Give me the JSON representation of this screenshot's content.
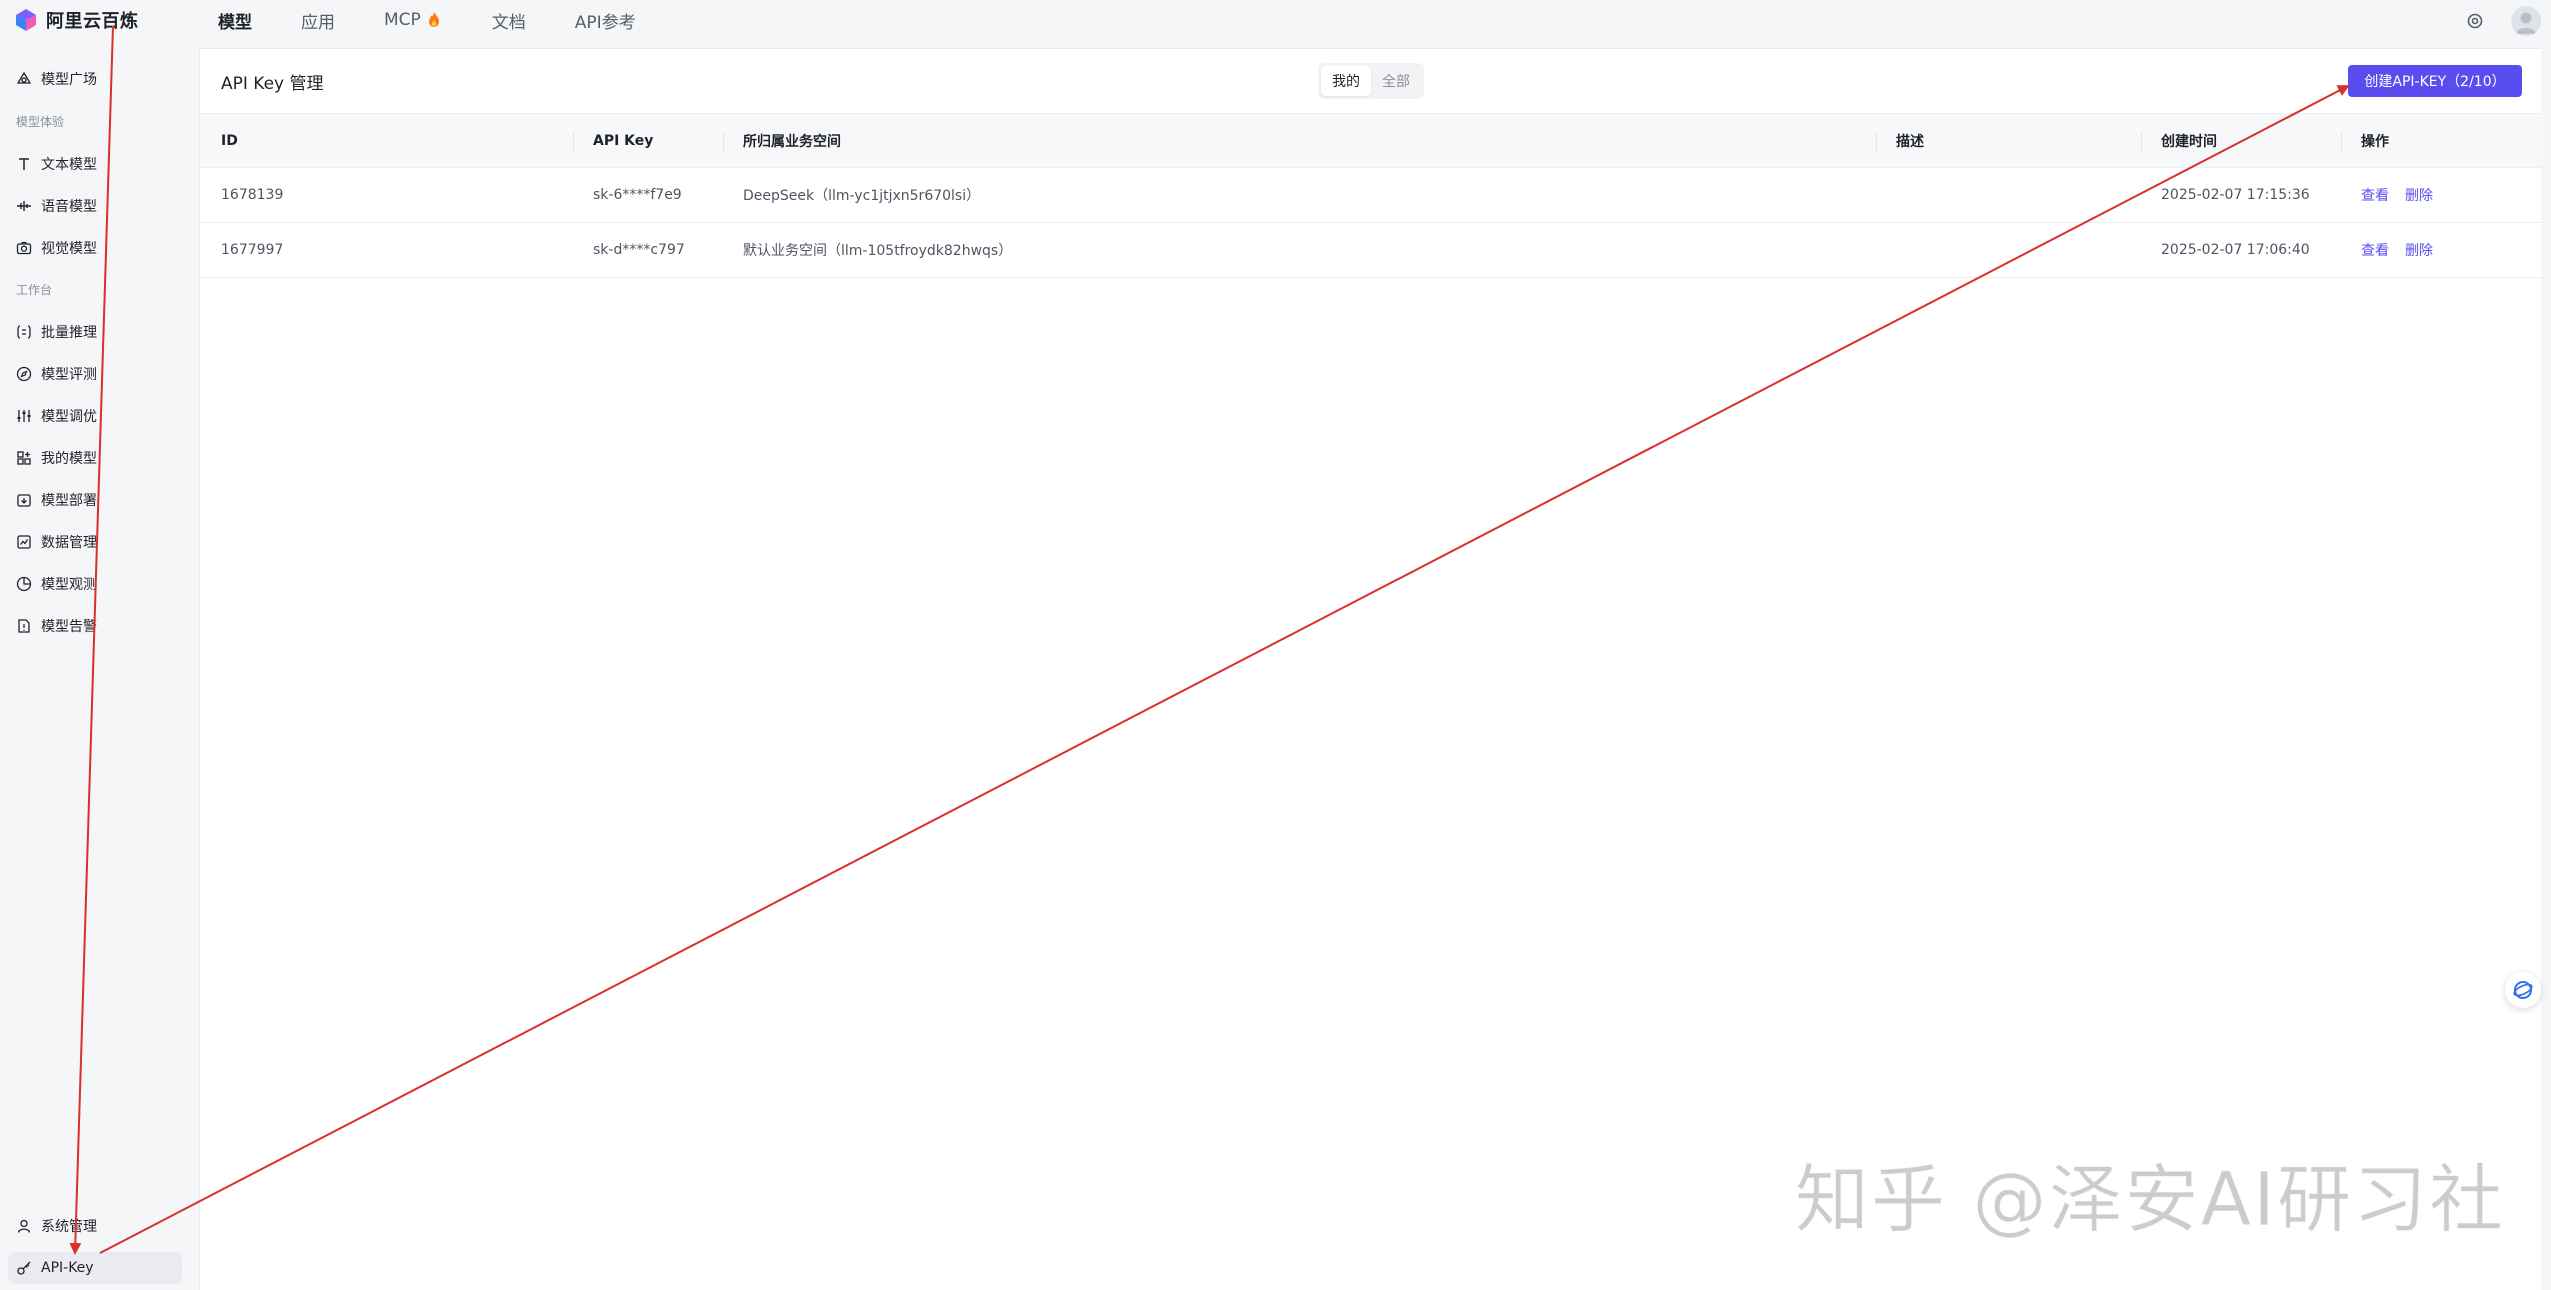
{
  "brand": {
    "name": "阿里云百炼"
  },
  "topnav": {
    "items": [
      {
        "label": "模型",
        "active": true
      },
      {
        "label": "应用",
        "active": false
      },
      {
        "label": "MCP",
        "active": false,
        "icon": "fire-icon"
      },
      {
        "label": "文档",
        "active": false
      },
      {
        "label": "API参考",
        "active": false
      }
    ]
  },
  "sidebar": {
    "top_item": "模型广场",
    "group_experience": "模型体验",
    "experience_items": [
      "文本模型",
      "语音模型",
      "视觉模型"
    ],
    "group_workbench": "工作台",
    "workbench_items": [
      "批量推理",
      "模型评测",
      "模型调优",
      "我的模型",
      "模型部署",
      "数据管理",
      "模型观测",
      "模型告警"
    ],
    "bottom_items": [
      "系统管理",
      "API-Key"
    ],
    "active_item": "API-Key"
  },
  "main": {
    "title": "API Key 管理",
    "segments": [
      "我的",
      "全部"
    ],
    "active_segment": "我的",
    "create_button": "创建API-KEY（2/10）"
  },
  "table": {
    "headers": [
      "ID",
      "API Key",
      "所归属业务空间",
      "描述",
      "创建时间",
      "操作"
    ],
    "rows": [
      {
        "id": "1678139",
        "key": "sk-6****f7e9",
        "workspace": "DeepSeek（llm-yc1jtjxn5r670lsi）",
        "desc": "",
        "created": "2025-02-07 17:15:36",
        "op_view": "查看",
        "op_delete": "删除"
      },
      {
        "id": "1677997",
        "key": "sk-d****c797",
        "workspace": "默认业务空间（llm-105tfroydk82hwqs）",
        "desc": "",
        "created": "2025-02-07 17:06:40",
        "op_view": "查看",
        "op_delete": "删除"
      }
    ]
  },
  "watermark": "知乎 @泽安AI研习社",
  "colors": {
    "accent": "#5a4df0",
    "annotation": "#d9302c"
  }
}
